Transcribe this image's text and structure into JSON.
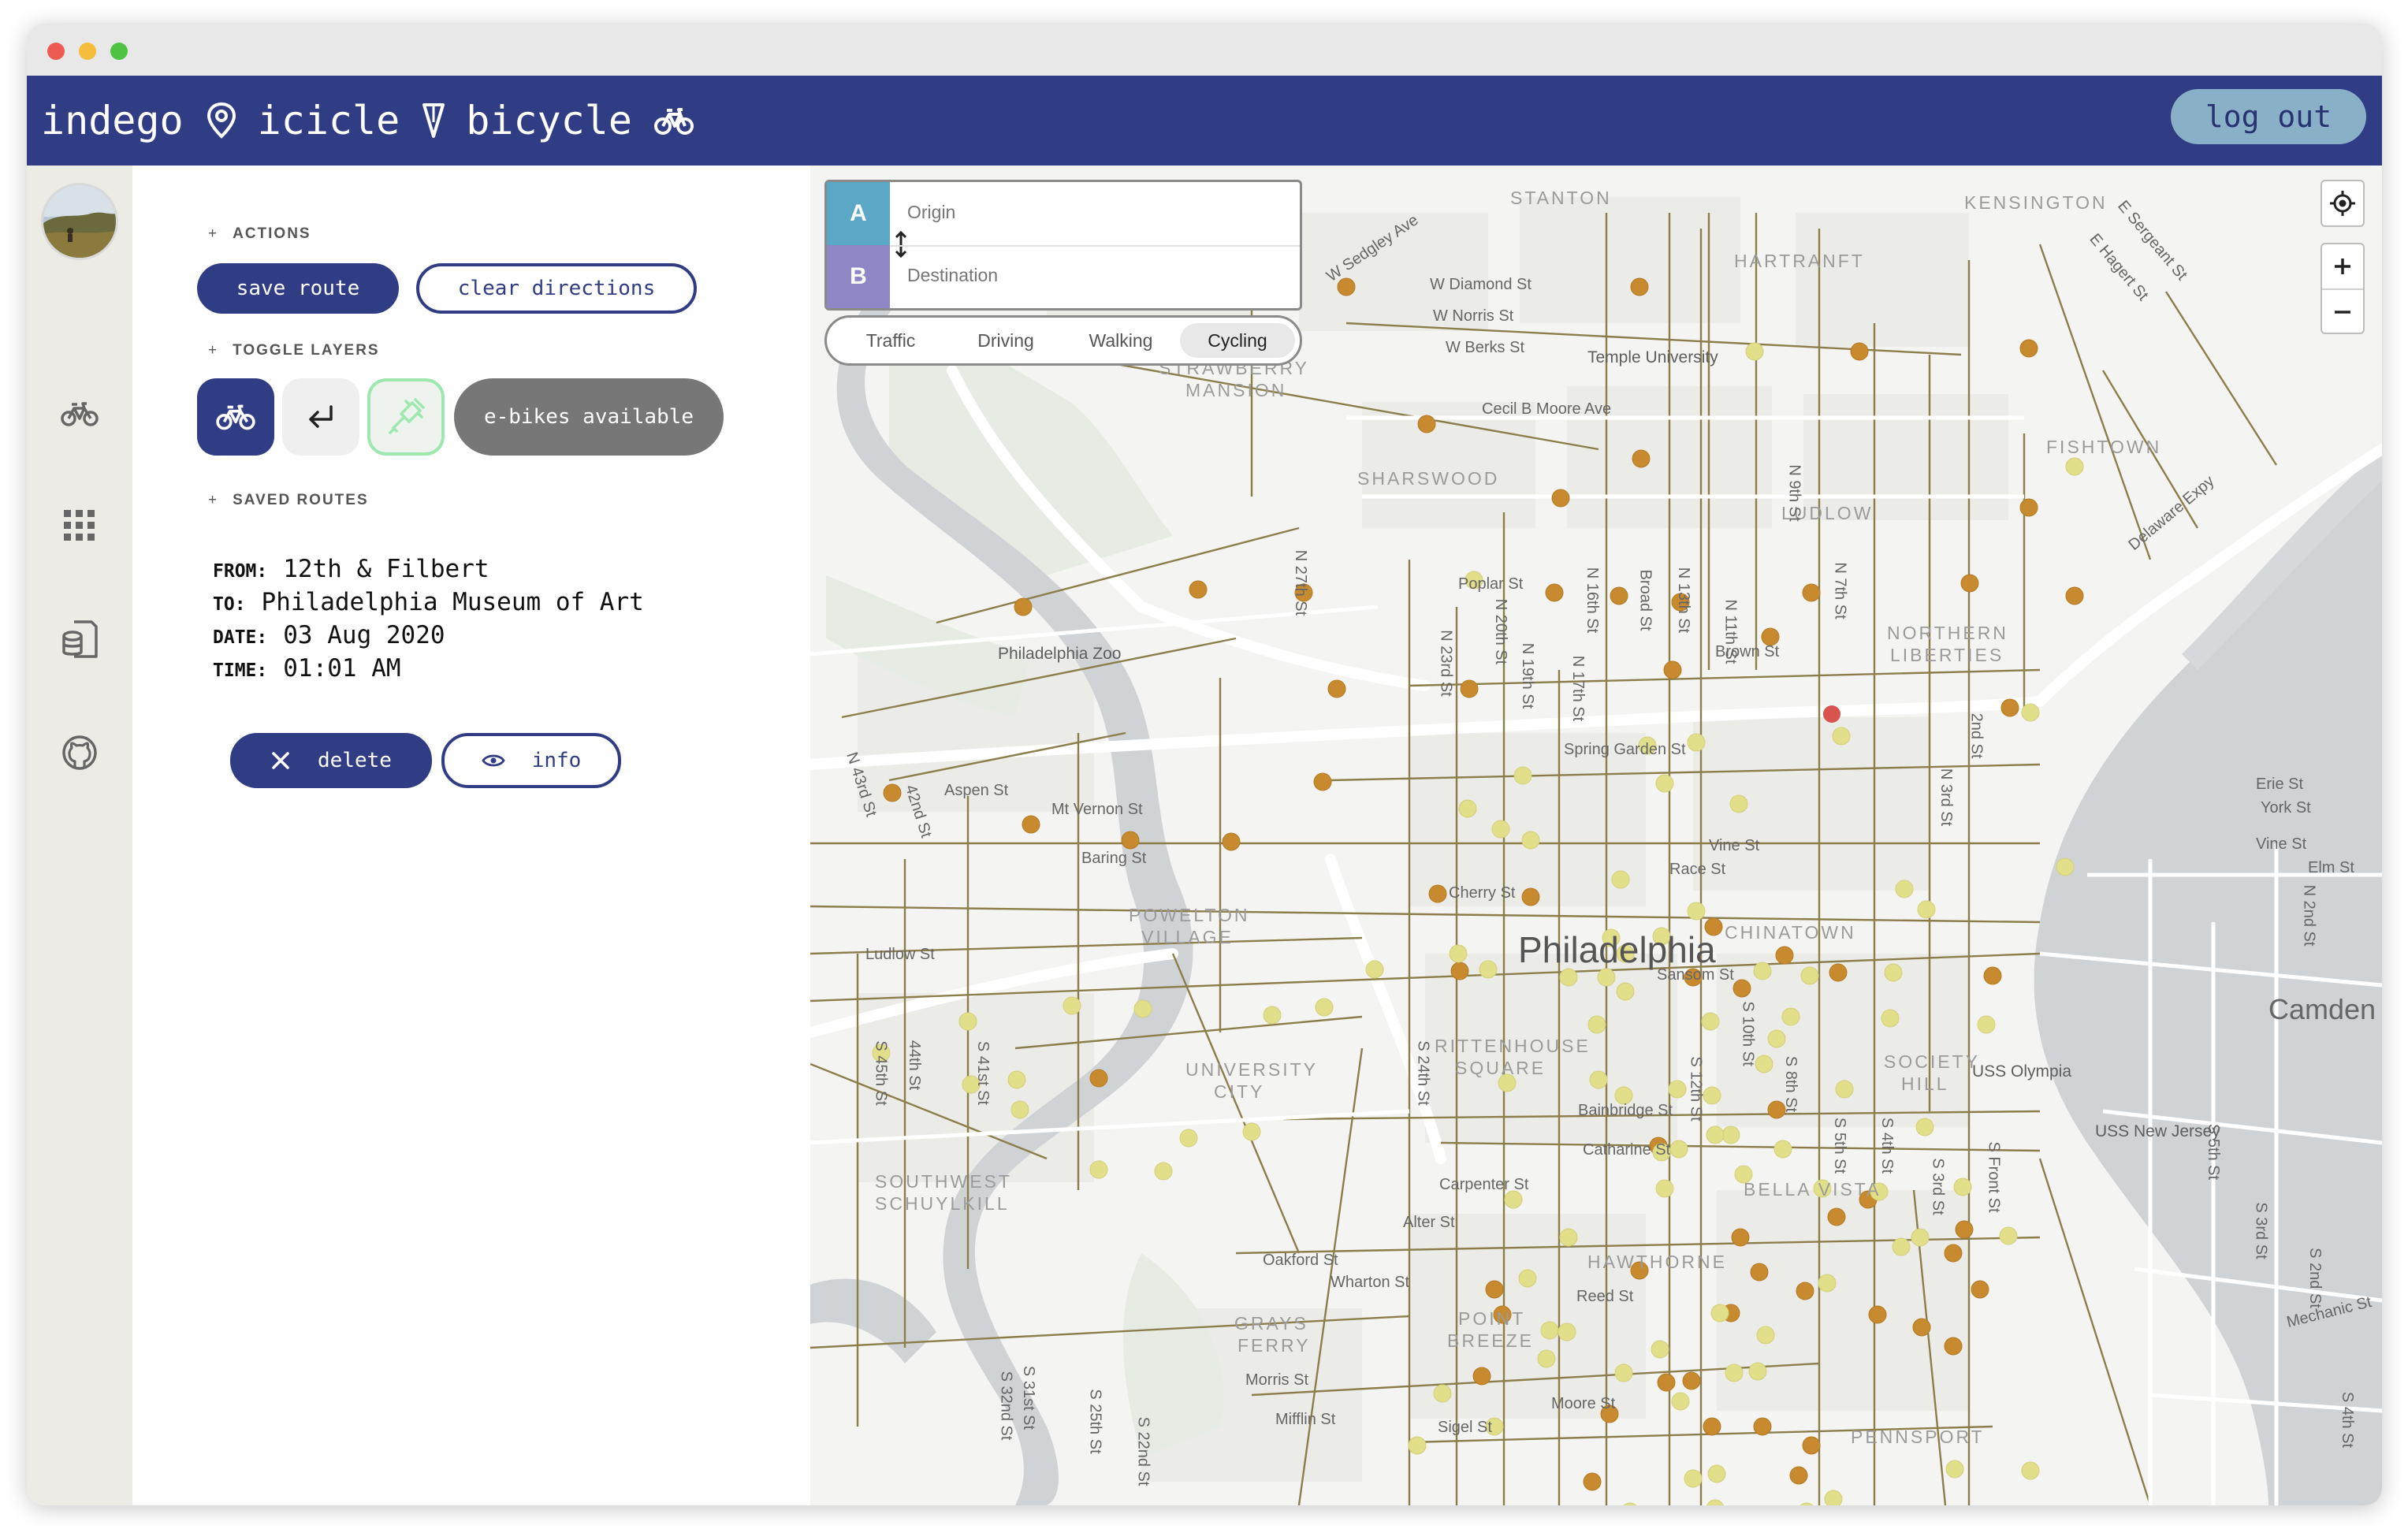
{
  "app": {
    "brand_words": [
      "indego",
      "icicle",
      "bicycle"
    ],
    "logout_label": "log out"
  },
  "rail": {
    "icons": [
      "bike-icon",
      "apps-grid-icon",
      "database-icon",
      "github-icon"
    ]
  },
  "panel": {
    "actions_heading": "ACTIONS",
    "save_route_label": "save route",
    "clear_directions_label": "clear directions",
    "toggle_layers_heading": "TOGGLE LAYERS",
    "ebikes_label": "e-bikes available",
    "saved_routes_heading": "SAVED ROUTES",
    "route": {
      "from_key": "FROM:",
      "from": "12th & Filbert",
      "to_key": "TO:",
      "to": "Philadelphia Museum of Art",
      "date_key": "DATE:",
      "date": "03 Aug 2020",
      "time_key": "TIME:",
      "time": "01:01 AM"
    },
    "delete_label": "delete",
    "info_label": "info"
  },
  "directions": {
    "a_label": "A",
    "b_label": "B",
    "origin_placeholder": "Origin",
    "destination_placeholder": "Destination",
    "modes": [
      "Traffic",
      "Driving",
      "Walking",
      "Cycling"
    ],
    "active_mode": "Cycling"
  },
  "map": {
    "city_label": "Philadelphia",
    "camden_label": "Camden",
    "neighborhoods": [
      "STANTON",
      "KENSINGTON",
      "HARTRANFT",
      "STRAWBERRY",
      "MANSION",
      "SHARSWOOD",
      "LUDLOW",
      "FISHTOWN",
      "NORTHERN",
      "LIBERTIES",
      "POWELTON",
      "VILLAGE",
      "CHINATOWN",
      "RITTENHOUSE",
      "SQUARE",
      "SOCIETY",
      "HILL",
      "UNIVERSITY",
      "CITY",
      "SOUTHWEST",
      "SCHUYLKILL",
      "BELLA VISTA",
      "HAWTHORNE",
      "POINT",
      "BREEZE",
      "GRAYS",
      "FERRY",
      "PENNSPORT"
    ],
    "places": [
      "Philadelphia Zoo",
      "Temple University",
      "USS Olympia",
      "USS New Jersey"
    ],
    "streets": [
      "W Diamond St",
      "W Norris St",
      "W Berks St",
      "Cecil B Moore Ave",
      "W Sedgley Ave",
      "Poplar St",
      "Brown St",
      "Spring Garden St",
      "Vine St",
      "Race St",
      "Cherry St",
      "Aspen St",
      "Mt Vernon St",
      "Baring St",
      "Ludlow St",
      "Sansom St",
      "Bainbridge St",
      "Catharine St",
      "Carpenter St",
      "Alter St",
      "Oakford St",
      "Wharton St",
      "Reed St",
      "Morris St",
      "Mifflin St",
      "Moore St",
      "Sigel St",
      "Erie St",
      "York St",
      "Vine St",
      "Elm St",
      "Mechanic St",
      "Delaware Expy",
      "E Sergeant St",
      "E Hagert St"
    ],
    "vertical_streets": [
      "N 16th St",
      "Broad St",
      "N 13th St",
      "N 11th St",
      "N 9th St",
      "N 7th St",
      "N 20th St",
      "N 19th St",
      "N 17th St",
      "N 23rd St",
      "N 27th St",
      "N 3rd St",
      "2nd St",
      "N 43rd St",
      "42nd St",
      "S 45th St",
      "44th St",
      "S 41st St",
      "S 24th St",
      "S 12th St",
      "S 10th St",
      "S 8th St",
      "S 5th St",
      "S 4th St",
      "S 3rd St",
      "S Front St",
      "S 32nd St",
      "S 31st St",
      "S 25th St",
      "S 22nd St",
      "S 5th St",
      "S 3rd St",
      "S 2nd St",
      "N 2nd St",
      "S 4th St"
    ],
    "stations": {
      "bikes_color": "#c88a2e",
      "ebikes_color": "#e2df8a",
      "alert_color": "#d9534f"
    }
  },
  "colors": {
    "primary": "#303c83",
    "logout_bg": "#8ab0c8",
    "a_badge": "#5aa7c6",
    "b_badge": "#8d87c5",
    "toggle_active": "#303c83",
    "ebike_toggle_border": "#9ee8b0"
  }
}
